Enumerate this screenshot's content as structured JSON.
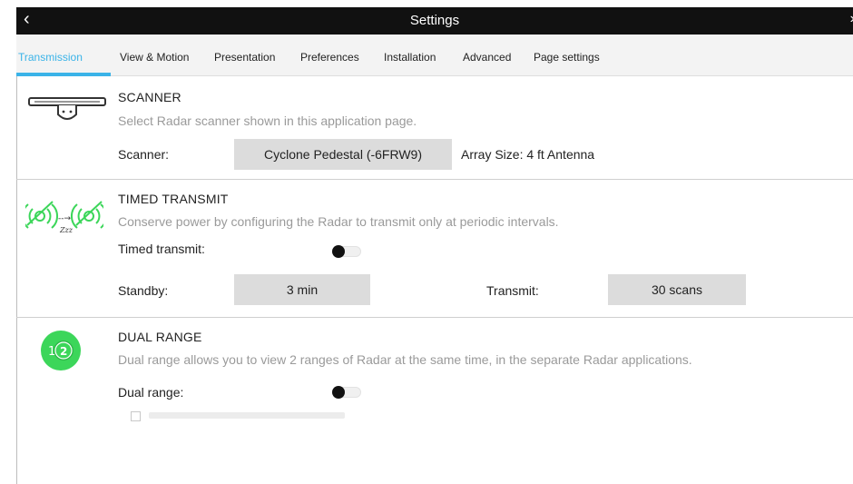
{
  "window": {
    "title": "Settings",
    "back_glyph": "‹",
    "close_glyph": "›"
  },
  "tabs": [
    {
      "label": "Transmission",
      "active": true
    },
    {
      "label": "View & Motion",
      "active": false
    },
    {
      "label": "Presentation",
      "active": false
    },
    {
      "label": "Preferences",
      "active": false
    },
    {
      "label": "Installation",
      "active": false
    },
    {
      "label": "Advanced",
      "active": false
    },
    {
      "label": "Page settings",
      "active": false
    }
  ],
  "scanner": {
    "icon": "radar-scanner-icon",
    "title": "SCANNER",
    "description": "Select Radar scanner shown in this application page.",
    "field_label": "Scanner:",
    "value": "Cyclone Pedestal (-6FRW9)",
    "array_size": "Array Size: 4 ft Antenna"
  },
  "timed_transmit": {
    "icon": "timed-transmit-icon",
    "icon_text": "Zzz",
    "title": "TIMED TRANSMIT",
    "description": "Conserve power by configuring the Radar to transmit only at periodic intervals.",
    "toggle_label": "Timed transmit:",
    "toggle_on": false,
    "standby_label": "Standby:",
    "standby_value": "3 min",
    "transmit_label": "Transmit:",
    "transmit_value": "30 scans"
  },
  "dual_range": {
    "icon": "dual-range-icon",
    "icon_digits": [
      "1",
      "2"
    ],
    "title": "DUAL RANGE",
    "description": "Dual range allows you to view 2 ranges of Radar at the same time, in the separate Radar applications.",
    "toggle_label": "Dual range:",
    "toggle_on": false,
    "checkbox_checked": false
  },
  "colors": {
    "accent": "#3ab3e8",
    "titlebar": "#111111",
    "icon_green": "#3cd65a",
    "button_bg": "#dcdcdc"
  }
}
